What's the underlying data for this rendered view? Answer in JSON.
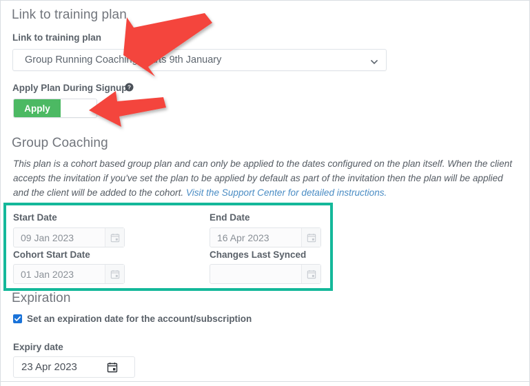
{
  "sections": {
    "link_plan": {
      "heading": "Link to training plan",
      "field_label": "Link to training plan",
      "select_value": "Group Running Coaching Starts 9th January",
      "select_chevron_icon": "chevron-down-icon",
      "apply_label": "Apply Plan During Signup",
      "help_icon": "help-circle-icon",
      "toggle_on_label": "Apply"
    },
    "group_coaching": {
      "heading": "Group Coaching",
      "description_part1": "This plan is a cohort based group plan and can only be applied to the dates configured on the plan itself. When the client accepts the invitation if you've set the plan to be applied by default as part of the invitation then the plan will be applied and the client will be added to the cohort. ",
      "link_text": "Visit the Support Center for detailed instructions.",
      "fields": {
        "start_date_label": "Start Date",
        "start_date_value": "09 Jan 2023",
        "end_date_label": "End Date",
        "end_date_value": "16 Apr 2023",
        "cohort_start_date_label": "Cohort Start Date",
        "cohort_start_date_value": "01 Jan 2023",
        "changes_last_synced_label": "Changes Last Synced",
        "changes_last_synced_value": ""
      },
      "calendar_icon": "calendar-icon"
    },
    "expiration": {
      "heading": "Expiration",
      "checkbox_label": "Set an expiration date for the account/subscription",
      "checkbox_checked": true,
      "expiry_label": "Expiry date",
      "expiry_value": "23 Apr 2023",
      "calendar_icon": "calendar-icon"
    }
  },
  "annotations": {
    "arrow_1_name": "red-arrow-pointing-to-select",
    "arrow_2_name": "red-arrow-pointing-to-toggle",
    "highlight_box_name": "teal-highlight-box"
  },
  "colors": {
    "accent_green": "#4cb963",
    "highlight_teal": "#14b89a",
    "arrow_red": "#f4443c",
    "checkbox_blue": "#1a73d9",
    "link_blue": "#4a8cc4",
    "heading_gray": "#71757c"
  }
}
